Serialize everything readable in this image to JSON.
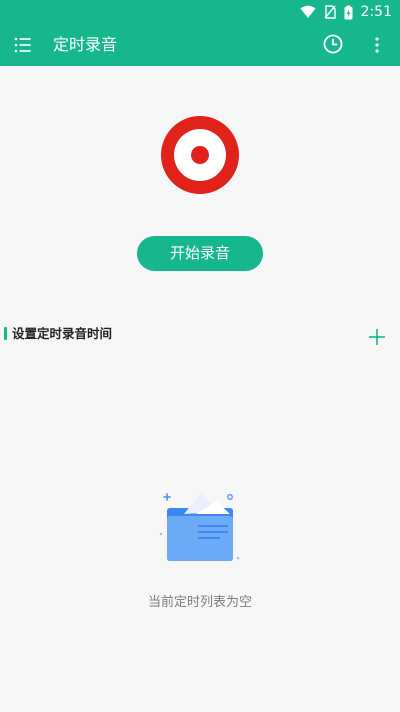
{
  "status_bar": {
    "time": "2:51"
  },
  "app_bar": {
    "title": "定时录音"
  },
  "main": {
    "start_button": "开始录音"
  },
  "schedule_section": {
    "title": "设置定时录音时间",
    "empty_text": "当前定时列表为空"
  },
  "colors": {
    "accent": "#16b78f",
    "record_red": "#e0221a"
  }
}
